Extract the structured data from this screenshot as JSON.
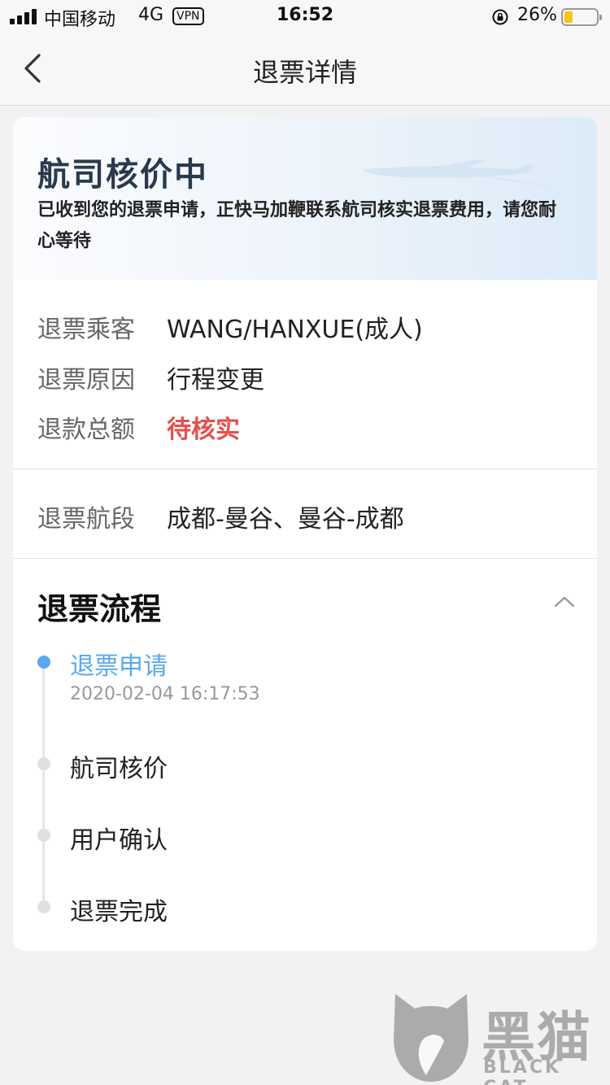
{
  "status_bar": {
    "carrier": "中国移动",
    "network": "4G",
    "vpn": "VPN",
    "time": "16:52",
    "battery": "26%",
    "battery_level": 0.26
  },
  "nav": {
    "title": "退票详情",
    "back_icon": "chevron-left-icon"
  },
  "banner": {
    "title": "航司核价中",
    "description": "已收到您的退票申请，正快马加鞭联系航司核实退票费用，请您耐心等待"
  },
  "info": {
    "passenger_label": "退票乘客",
    "passenger_value": "WANG/HANXUE(成人)",
    "reason_label": "退票原因",
    "reason_value": "行程变更",
    "amount_label": "退款总额",
    "amount_value": "待核实",
    "segment_label": "退票航段",
    "segment_value": "成都-曼谷、曼谷-成都"
  },
  "flow": {
    "title": "退票流程",
    "toggle_icon": "chevron-up-icon",
    "steps": [
      {
        "label": "退票申请",
        "time": "2020-02-04 16:17:53",
        "active": true
      },
      {
        "label": "航司核价",
        "active": false
      },
      {
        "label": "用户确认",
        "active": false
      },
      {
        "label": "退票完成",
        "active": false
      }
    ]
  },
  "watermark": {
    "cn": "黑猫",
    "en": "BLACK CAT"
  },
  "colors": {
    "accent": "#5aa8f0",
    "pending": "#e5504c",
    "background": "#f2f2f5"
  }
}
